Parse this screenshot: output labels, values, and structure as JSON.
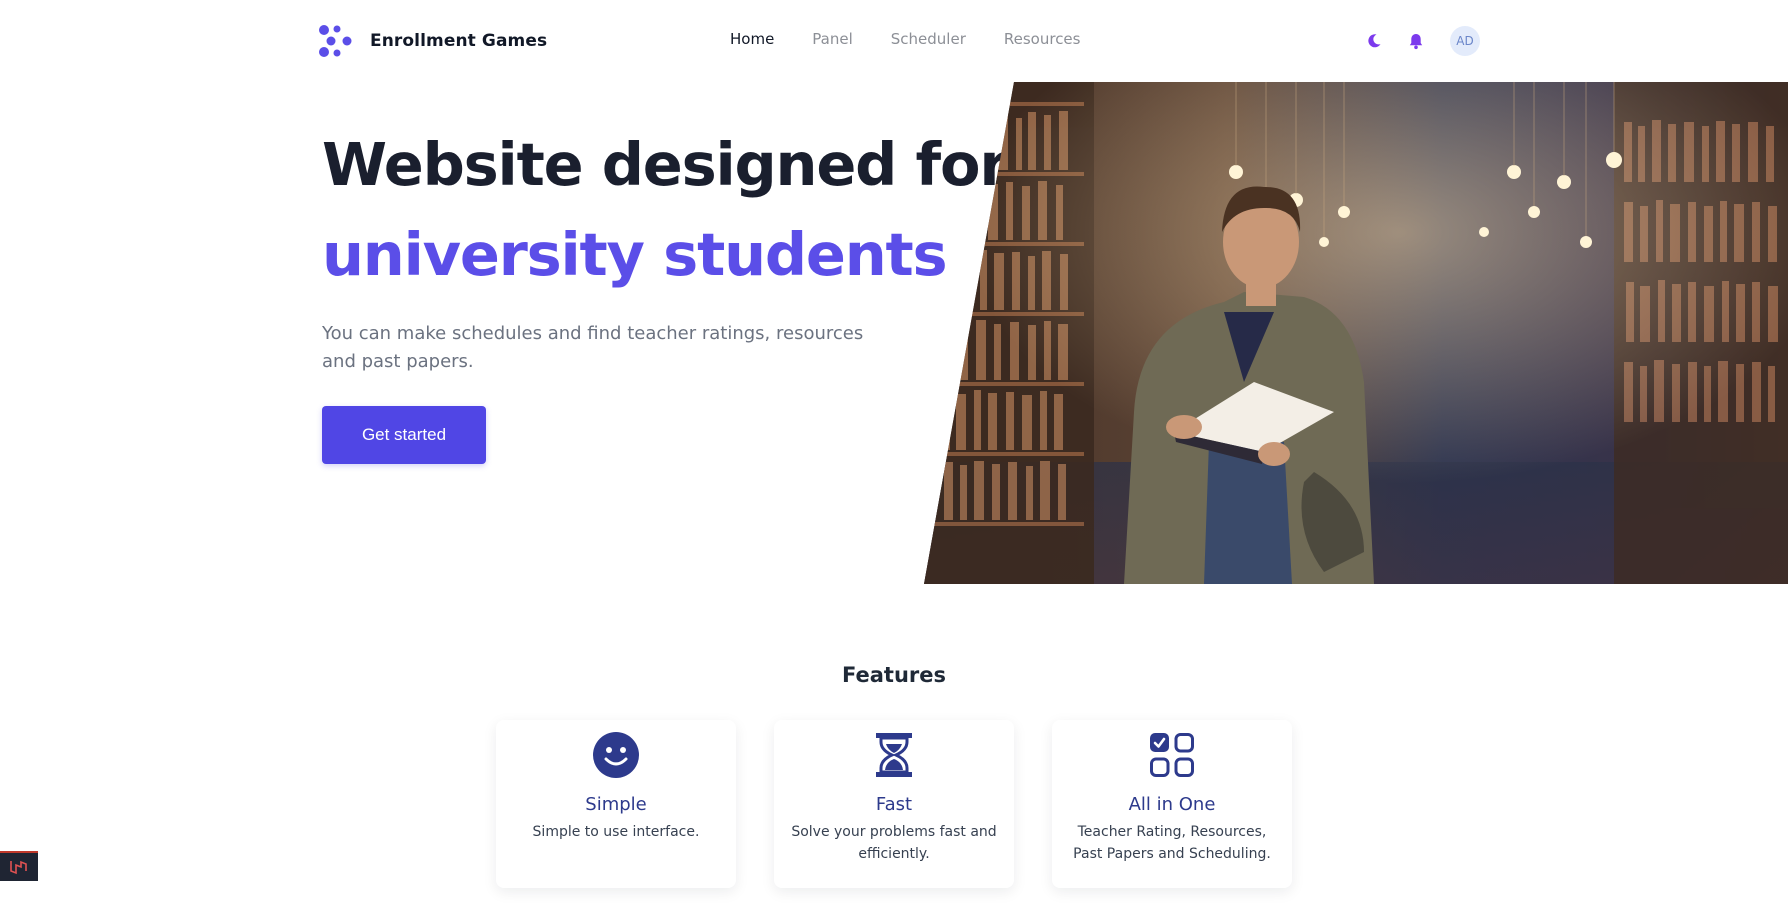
{
  "brand": {
    "name": "Enrollment Games",
    "logo_icon": "molecule-logo-icon",
    "color": "#5b4ee8"
  },
  "nav": {
    "links": [
      {
        "label": "Home",
        "active": true
      },
      {
        "label": "Panel",
        "active": false
      },
      {
        "label": "Scheduler",
        "active": false
      },
      {
        "label": "Resources",
        "active": false
      }
    ],
    "theme_icon": "moon-icon",
    "notification_icon": "bell-icon",
    "avatar_initials": "AD"
  },
  "hero": {
    "title_line1": "Website designed for",
    "title_line2": "university students",
    "subtitle": "You can make schedules and find teacher ratings, resources and past papers.",
    "cta_label": "Get started",
    "image": "student-reading-in-library-photo"
  },
  "features": {
    "title": "Features",
    "items": [
      {
        "icon": "smiley-icon",
        "title": "Simple",
        "desc": "Simple to use interface."
      },
      {
        "icon": "hourglass-icon",
        "title": "Fast",
        "desc": "Solve your problems fast and efficiently."
      },
      {
        "icon": "grid-check-icon",
        "title": "All in One",
        "desc": "Teacher Rating, Resources, Past Papers and Scheduling."
      }
    ]
  },
  "colors": {
    "accent": "#5046e5",
    "accent_text": "#5b4ee8",
    "feature_icon": "#2d3a8c"
  },
  "debug_badge_icon": "laravel-debugbar-icon"
}
